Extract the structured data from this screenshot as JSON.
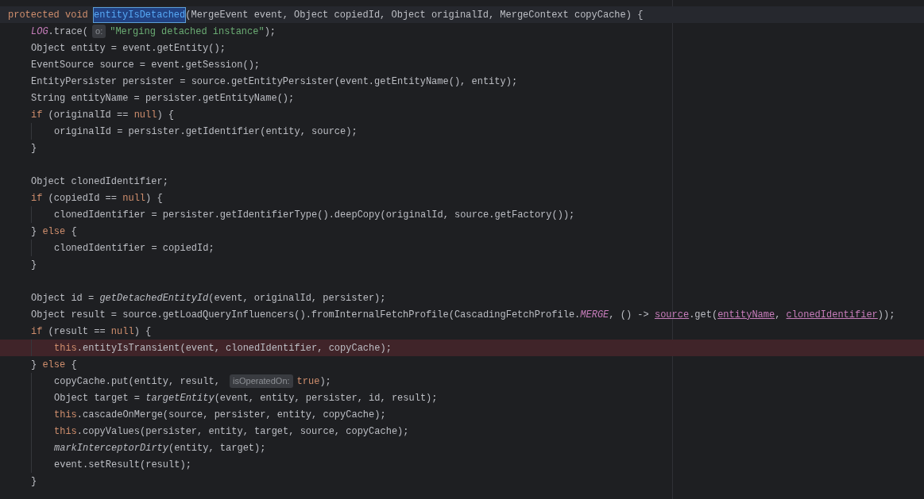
{
  "editor": {
    "lines": [
      {
        "current": true,
        "error": false,
        "tokens": [
          {
            "kind": "keyword",
            "text": "protected void "
          },
          {
            "kind": "selected-name",
            "text": "entityIsDetached"
          },
          {
            "kind": "plain",
            "text": "(MergeEvent event, Object copiedId, Object originalId, MergeContext copyCache) {"
          }
        ],
        "children": [
          {
            "current": false,
            "error": false,
            "tokens": [
              {
                "kind": "static",
                "text": "LOG"
              },
              {
                "kind": "plain",
                "text": ".trace("
              },
              {
                "kind": "hint",
                "text": "o:"
              },
              {
                "kind": "string",
                "text": "\"Merging detached instance\""
              },
              {
                "kind": "plain",
                "text": ");"
              }
            ]
          },
          {
            "current": false,
            "error": false,
            "tokens": [
              {
                "kind": "plain",
                "text": "Object entity = event.getEntity();"
              }
            ]
          },
          {
            "current": false,
            "error": false,
            "tokens": [
              {
                "kind": "plain",
                "text": "EventSource source = event.getSession();"
              }
            ]
          },
          {
            "current": false,
            "error": false,
            "tokens": [
              {
                "kind": "plain",
                "text": "EntityPersister persister = source.getEntityPersister(event.getEntityName(), entity);"
              }
            ]
          },
          {
            "current": false,
            "error": false,
            "tokens": [
              {
                "kind": "plain",
                "text": "String entityName = persister.getEntityName();"
              }
            ]
          },
          {
            "current": false,
            "error": false,
            "tokens": [
              {
                "kind": "keyword",
                "text": "if"
              },
              {
                "kind": "plain",
                "text": " (originalId == "
              },
              {
                "kind": "keyword",
                "text": "null"
              },
              {
                "kind": "plain",
                "text": ") {"
              }
            ],
            "children": [
              {
                "current": false,
                "error": false,
                "tokens": [
                  {
                    "kind": "plain",
                    "text": "originalId = persister.getIdentifier(entity, source);"
                  }
                ]
              }
            ]
          },
          {
            "current": false,
            "error": false,
            "tokens": [
              {
                "kind": "plain",
                "text": "}"
              }
            ]
          },
          {
            "current": false,
            "error": false
          },
          {
            "current": false,
            "error": false,
            "tokens": [
              {
                "kind": "plain",
                "text": "Object clonedIdentifier;"
              }
            ]
          },
          {
            "current": false,
            "error": false,
            "tokens": [
              {
                "kind": "keyword",
                "text": "if"
              },
              {
                "kind": "plain",
                "text": " (copiedId == "
              },
              {
                "kind": "keyword",
                "text": "null"
              },
              {
                "kind": "plain",
                "text": ") {"
              }
            ],
            "children": [
              {
                "current": false,
                "error": false,
                "tokens": [
                  {
                    "kind": "plain",
                    "text": "clonedIdentifier = persister.getIdentifierType().deepCopy(originalId, source.getFactory());"
                  }
                ]
              }
            ]
          },
          {
            "current": false,
            "error": false,
            "tokens": [
              {
                "kind": "plain",
                "text": "} "
              },
              {
                "kind": "keyword",
                "text": "else"
              },
              {
                "kind": "plain",
                "text": " {"
              }
            ],
            "children": [
              {
                "current": false,
                "error": false,
                "tokens": [
                  {
                    "kind": "plain",
                    "text": "clonedIdentifier = copiedId;"
                  }
                ]
              }
            ]
          },
          {
            "current": false,
            "error": false,
            "tokens": [
              {
                "kind": "plain",
                "text": "}"
              }
            ]
          },
          {
            "current": false,
            "error": false
          },
          {
            "current": false,
            "error": false,
            "tokens": [
              {
                "kind": "plain",
                "text": "Object id = "
              },
              {
                "kind": "italic",
                "text": "getDetachedEntityId"
              },
              {
                "kind": "plain",
                "text": "(event, originalId, persister);"
              }
            ]
          },
          {
            "current": false,
            "error": false,
            "tokens": [
              {
                "kind": "plain",
                "text": "Object result = source.getLoadQueryInfluencers().fromInternalFetchProfile(CascadingFetchProfile."
              },
              {
                "kind": "static",
                "text": "MERGE"
              },
              {
                "kind": "plain",
                "text": ", () -> "
              },
              {
                "kind": "captured",
                "text": "source"
              },
              {
                "kind": "plain",
                "text": ".get("
              },
              {
                "kind": "captured",
                "text": "entityName"
              },
              {
                "kind": "plain",
                "text": ", "
              },
              {
                "kind": "captured",
                "text": "clonedIdentifier"
              },
              {
                "kind": "plain",
                "text": "));"
              }
            ]
          },
          {
            "current": false,
            "error": false,
            "tokens": [
              {
                "kind": "keyword",
                "text": "if"
              },
              {
                "kind": "plain",
                "text": " (result == "
              },
              {
                "kind": "keyword",
                "text": "null"
              },
              {
                "kind": "plain",
                "text": ") {"
              }
            ],
            "children": [
              {
                "current": false,
                "error": true,
                "tokens": [
                  {
                    "kind": "keyword",
                    "text": "this"
                  },
                  {
                    "kind": "plain",
                    "text": ".entityIsTransient(event, clonedIdentifier, copyCache);"
                  }
                ]
              }
            ]
          },
          {
            "current": false,
            "error": false,
            "tokens": [
              {
                "kind": "plain",
                "text": "} "
              },
              {
                "kind": "keyword",
                "text": "else"
              },
              {
                "kind": "plain",
                "text": " {"
              }
            ],
            "children": [
              {
                "current": false,
                "error": false,
                "tokens": [
                  {
                    "kind": "plain",
                    "text": "copyCache.put(entity, result, "
                  },
                  {
                    "kind": "hint",
                    "text": "isOperatedOn:"
                  },
                  {
                    "kind": "keyword",
                    "text": "true"
                  },
                  {
                    "kind": "plain",
                    "text": ");"
                  }
                ]
              },
              {
                "current": false,
                "error": false,
                "tokens": [
                  {
                    "kind": "plain",
                    "text": "Object target = "
                  },
                  {
                    "kind": "italic",
                    "text": "targetEntity"
                  },
                  {
                    "kind": "plain",
                    "text": "(event, entity, persister, id, result);"
                  }
                ]
              },
              {
                "current": false,
                "error": false,
                "tokens": [
                  {
                    "kind": "keyword",
                    "text": "this"
                  },
                  {
                    "kind": "plain",
                    "text": ".cascadeOnMerge(source, persister, entity, copyCache);"
                  }
                ]
              },
              {
                "current": false,
                "error": false,
                "tokens": [
                  {
                    "kind": "keyword",
                    "text": "this"
                  },
                  {
                    "kind": "plain",
                    "text": ".copyValues(persister, entity, target, source, copyCache);"
                  }
                ]
              },
              {
                "current": false,
                "error": false,
                "tokens": [
                  {
                    "kind": "italic",
                    "text": "markInterceptorDirty"
                  },
                  {
                    "kind": "plain",
                    "text": "(entity, target);"
                  }
                ]
              },
              {
                "current": false,
                "error": false,
                "tokens": [
                  {
                    "kind": "plain",
                    "text": "event.setResult(result);"
                  }
                ]
              }
            ]
          },
          {
            "current": false,
            "error": false,
            "tokens": [
              {
                "kind": "plain",
                "text": "}"
              }
            ]
          }
        ]
      }
    ]
  }
}
